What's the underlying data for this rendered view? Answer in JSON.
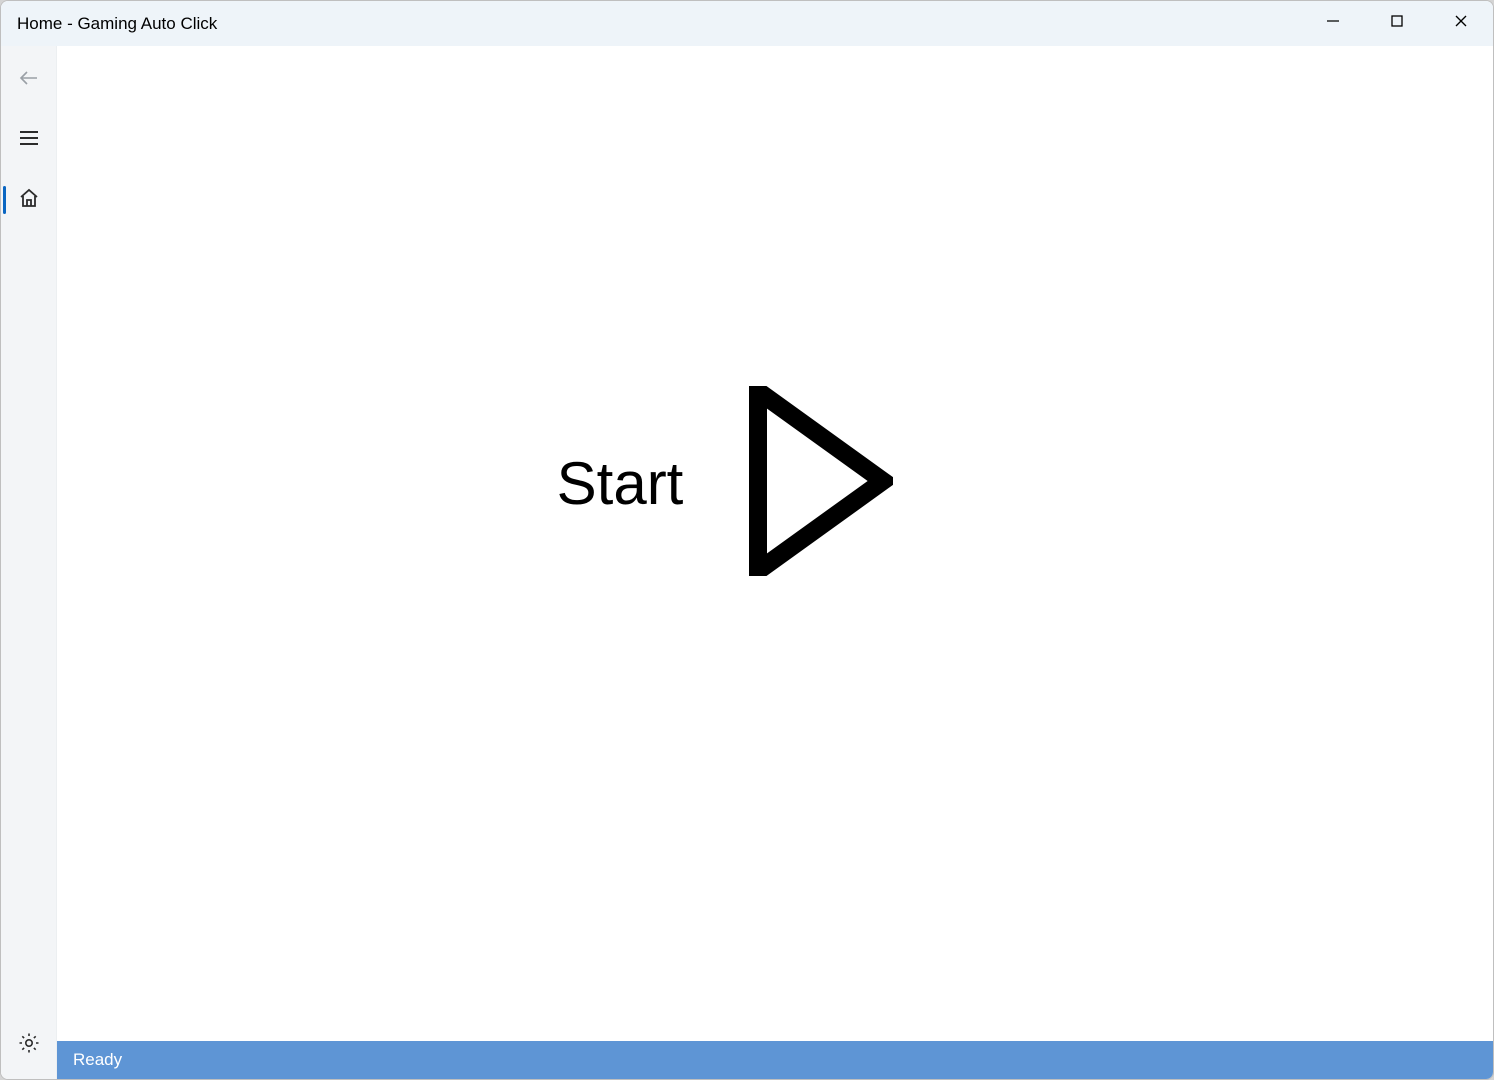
{
  "window": {
    "title": "Home - Gaming Auto Click"
  },
  "sidebar": {
    "back": "Back",
    "menu": "Menu",
    "home": "Home",
    "settings": "Settings"
  },
  "main": {
    "start_label": "Start"
  },
  "statusbar": {
    "status": "Ready"
  }
}
